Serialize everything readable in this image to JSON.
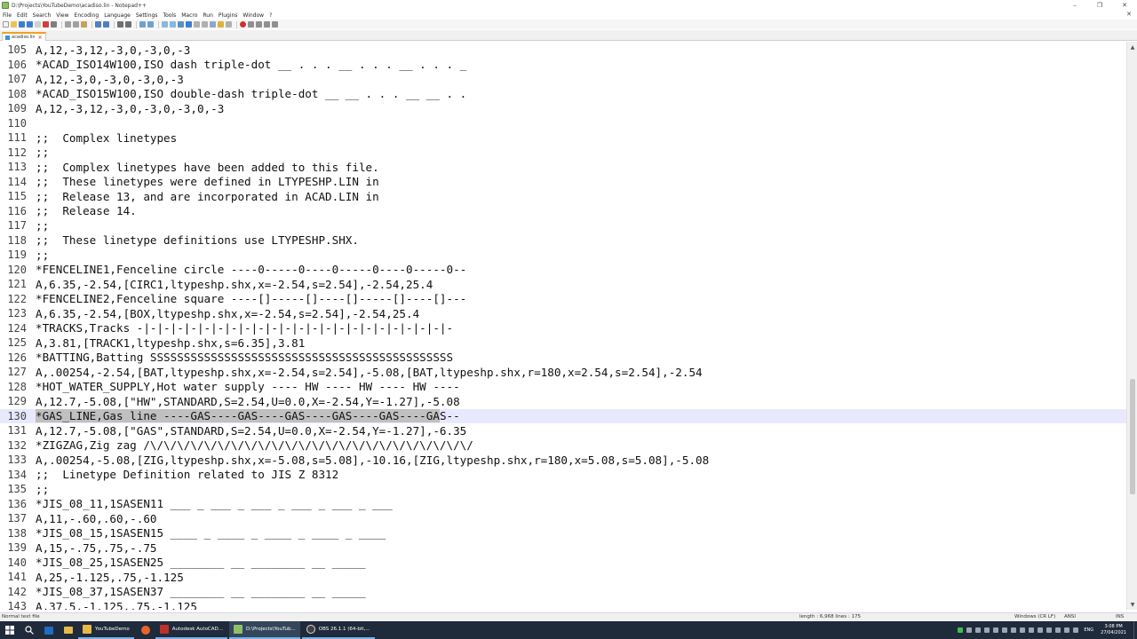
{
  "window": {
    "title": "D:\\Projects\\YouTubeDemo\\acadiso.lin - Notepad++",
    "minimize": "–",
    "maximize": "❐",
    "close": "✕"
  },
  "menu": {
    "items": [
      "File",
      "Edit",
      "Search",
      "View",
      "Encoding",
      "Language",
      "Settings",
      "Tools",
      "Macro",
      "Run",
      "Plugins",
      "Window",
      "?"
    ],
    "close_doc": "✕"
  },
  "tab": {
    "label": "acadiso.lin",
    "close": "✕"
  },
  "editor": {
    "current_line": 130,
    "lines": [
      {
        "n": "105",
        "t": "A,12,-3,12,-3,0,-3,0,-3"
      },
      {
        "n": "106",
        "t": "*ACAD_ISO14W100,ISO dash triple-dot __ . . . __ . . . __ . . . _"
      },
      {
        "n": "107",
        "t": "A,12,-3,0,-3,0,-3,0,-3"
      },
      {
        "n": "108",
        "t": "*ACAD_ISO15W100,ISO double-dash triple-dot __ __ . . . __ __ . ."
      },
      {
        "n": "109",
        "t": "A,12,-3,12,-3,0,-3,0,-3,0,-3"
      },
      {
        "n": "110",
        "t": ""
      },
      {
        "n": "111",
        "t": ";;  Complex linetypes"
      },
      {
        "n": "112",
        "t": ";;"
      },
      {
        "n": "113",
        "t": ";;  Complex linetypes have been added to this file."
      },
      {
        "n": "114",
        "t": ";;  These linetypes were defined in LTYPESHP.LIN in"
      },
      {
        "n": "115",
        "t": ";;  Release 13, and are incorporated in ACAD.LIN in"
      },
      {
        "n": "116",
        "t": ";;  Release 14."
      },
      {
        "n": "117",
        "t": ";;"
      },
      {
        "n": "118",
        "t": ";;  These linetype definitions use LTYPESHP.SHX."
      },
      {
        "n": "119",
        "t": ";;"
      },
      {
        "n": "120",
        "t": "*FENCELINE1,Fenceline circle ----0-----0----0-----0----0-----0--"
      },
      {
        "n": "121",
        "t": "A,6.35,-2.54,[CIRC1,ltypeshp.shx,x=-2.54,s=2.54],-2.54,25.4"
      },
      {
        "n": "122",
        "t": "*FENCELINE2,Fenceline square ----[]-----[]----[]-----[]----[]---"
      },
      {
        "n": "123",
        "t": "A,6.35,-2.54,[BOX,ltypeshp.shx,x=-2.54,s=2.54],-2.54,25.4"
      },
      {
        "n": "124",
        "t": "*TRACKS,Tracks -|-|-|-|-|-|-|-|-|-|-|-|-|-|-|-|-|-|-|-|-|-|-|-"
      },
      {
        "n": "125",
        "t": "A,3.81,[TRACK1,ltypeshp.shx,s=6.35],3.81"
      },
      {
        "n": "126",
        "t": "*BATTING,Batting SSSSSSSSSSSSSSSSSSSSSSSSSSSSSSSSSSSSSSSSSSSSS"
      },
      {
        "n": "127",
        "t": "A,.00254,-2.54,[BAT,ltypeshp.shx,x=-2.54,s=2.54],-5.08,[BAT,ltypeshp.shx,r=180,x=2.54,s=2.54],-2.54"
      },
      {
        "n": "128",
        "t": "*HOT_WATER_SUPPLY,Hot water supply ---- HW ---- HW ---- HW ----"
      },
      {
        "n": "129",
        "t": "A,12.7,-5.08,[\"HW\",STANDARD,S=2.54,U=0.0,X=-2.54,Y=-1.27],-5.08"
      },
      {
        "n": "130",
        "t": "*GAS_LINE,Gas line ----GAS----GAS----GAS----GAS----GAS----GAS--"
      },
      {
        "n": "131",
        "t": "A,12.7,-5.08,[\"GAS\",STANDARD,S=2.54,U=0.0,X=-2.54,Y=-1.27],-6.35"
      },
      {
        "n": "132",
        "t": "*ZIGZAG,Zig zag /\\/\\/\\/\\/\\/\\/\\/\\/\\/\\/\\/\\/\\/\\/\\/\\/\\/\\/\\/\\/\\/\\/\\/\\/"
      },
      {
        "n": "133",
        "t": "A,.00254,-5.08,[ZIG,ltypeshp.shx,x=-5.08,s=5.08],-10.16,[ZIG,ltypeshp.shx,r=180,x=5.08,s=5.08],-5.08"
      },
      {
        "n": "134",
        "t": ";;  Linetype Definition related to JIS Z 8312"
      },
      {
        "n": "135",
        "t": ";;"
      },
      {
        "n": "136",
        "t": "*JIS_08_11,1SASEN11 ___ _ ___ _ ___ _ ___ _ ___ _ ___"
      },
      {
        "n": "137",
        "t": "A,11,-.60,.60,-.60"
      },
      {
        "n": "138",
        "t": "*JIS_08_15,1SASEN15 ____ _ ____ _ ____ _ ____ _ ____"
      },
      {
        "n": "139",
        "t": "A,15,-.75,.75,-.75"
      },
      {
        "n": "140",
        "t": "*JIS_08_25,1SASEN25 ________ __ ________ __ _____"
      },
      {
        "n": "141",
        "t": "A,25,-1.125,.75,-1.125"
      },
      {
        "n": "142",
        "t": "*JIS_08_37,1SASEN37 ________ __ ________ __ _____"
      },
      {
        "n": "143",
        "t": "A,37.5,-1.125,.75,-1.125"
      }
    ],
    "selection_line_130_selected": "*GAS_LINE,Gas line ----GAS----GAS----GAS----GAS----GAS----GA",
    "selection_line_130_rest": "S--"
  },
  "status": {
    "mode": "Normal text file",
    "length": "length : 6,968   lines : 175",
    "eol": "Windows (CR LF)",
    "encoding": "ANSI",
    "ins": "INS"
  },
  "taskbar": {
    "apps": [
      {
        "label": "YouTubeDemo",
        "color": "#e8b84a"
      },
      {
        "label": "Autodesk AutoCAD...",
        "color": "#c0302a"
      },
      {
        "label": "D:\\Projects\\YouTub...",
        "color": "#8fbf6a"
      },
      {
        "label": "OBS 26.1.1 (64-bit,...",
        "color": "#404040"
      }
    ],
    "lang": "ENG",
    "time": "3:08 PM",
    "date": "27/04/2021"
  }
}
